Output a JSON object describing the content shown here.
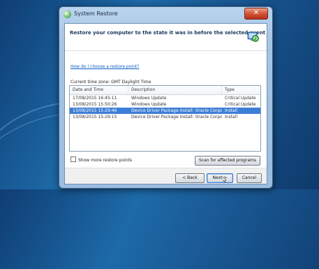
{
  "window": {
    "title": "System Restore",
    "close_glyph": "✕",
    "icon": "system-restore-icon"
  },
  "header": {
    "text": "Restore your computer to the state it was in before the selected event",
    "icon": "restore-wizard-icon"
  },
  "help_link": "How do I choose a restore point?",
  "timezone": "Current time zone: GMT Daylight Time",
  "table": {
    "columns": [
      "Date and Time",
      "Description",
      "Type"
    ],
    "rows": [
      {
        "date": "17/08/2015 16:45:11",
        "description": "Windows Update",
        "type": "Critical Update"
      },
      {
        "date": "13/08/2015 15:50:26",
        "description": "Windows Update",
        "type": "Critical Update"
      },
      {
        "date": "13/08/2015 15:29:46",
        "description": "Device Driver Package Install: Oracle Corporatio...",
        "type": "Install"
      },
      {
        "date": "13/08/2015 15:29:15",
        "description": "Device Driver Package Install: Oracle Corporatio...",
        "type": "Install"
      }
    ],
    "selected_row": 2
  },
  "show_more": {
    "label": "Show more restore points",
    "checked": false
  },
  "buttons": {
    "scan": "Scan for affected programs",
    "back": "< Back",
    "next": "Next >",
    "cancel": "Cancel"
  }
}
